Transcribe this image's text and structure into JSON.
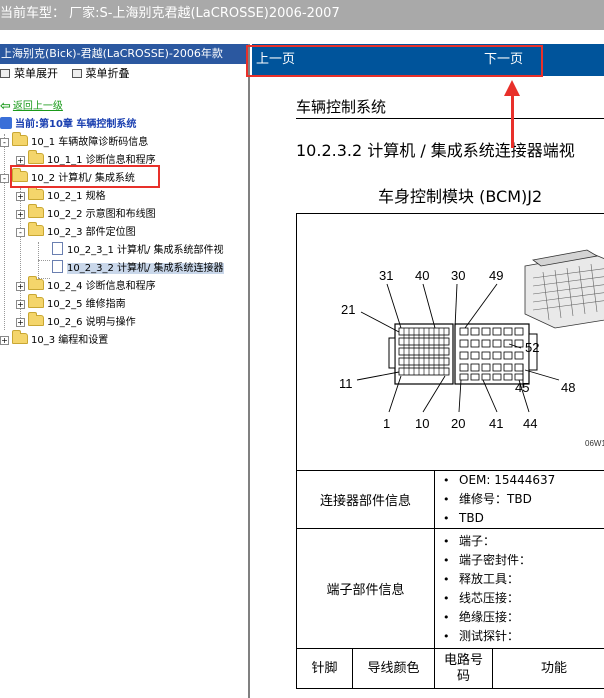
{
  "window": {
    "title": "当前车型：   厂家:S-上海别克君越(LaCROSSE)2006-2007"
  },
  "left_panel": {
    "header": "上海别克(Bick)-君越(LaCROSSE)-2006年款",
    "toolbar": {
      "expand_label": "菜单展开",
      "collapse_label": "菜单折叠"
    },
    "back_link": "返回上一级",
    "current_chapter": "当前:第10章 车辆控制系统",
    "tree": [
      {
        "label": "10_1 车辆故障诊断码信息",
        "expander": "-"
      },
      {
        "label": "10_1_1 诊断信息和程序",
        "expander": "+"
      },
      {
        "label": "10_2 计算机/ 集成系统",
        "expander": "-"
      },
      {
        "label": "10_2_1 规格",
        "expander": "+"
      },
      {
        "label": "10_2_2 示意图和布线图",
        "expander": "+"
      },
      {
        "label": "10_2_3 部件定位图",
        "expander": "-"
      },
      {
        "label": "10_2_3_1 计算机/ 集成系统部件视",
        "expander": ""
      },
      {
        "label": "10_2_3_2 计算机/ 集成系统连接器",
        "expander": ""
      },
      {
        "label": "10_2_4 诊断信息和程序",
        "expander": "+"
      },
      {
        "label": "10_2_5 维修指南",
        "expander": "+"
      },
      {
        "label": "10_2_6 说明与操作",
        "expander": "+"
      },
      {
        "label": "10_3 编程和设置",
        "expander": "+"
      }
    ]
  },
  "right_panel": {
    "nav": {
      "prev_label": "上一页",
      "next_label": "下一页"
    },
    "section_title": "车辆控制系统",
    "subsection_title": "10.2.3.2 计算机 / 集成系统连接器端视",
    "module_title": "车身控制模块 (BCM)J2",
    "diagram": {
      "pin_labels_top": [
        "31",
        "40",
        "30",
        "49"
      ],
      "pin_labels_left": [
        "21",
        "11"
      ],
      "pin_labels_right": [
        "52",
        "45",
        "48"
      ],
      "pin_labels_bottom": [
        "1",
        "10",
        "20",
        "41",
        "44"
      ],
      "figure_code": "06W1"
    },
    "connector_info": {
      "label": "连接器部件信息",
      "items": [
        "OEM: 15444637",
        "维修号：TBD",
        "TBD"
      ]
    },
    "terminal_info": {
      "label": "端子部件信息",
      "items": [
        "端子：",
        "端子密封件：",
        "释放工具：",
        "线芯压接：",
        "绝缘压接：",
        "测试探针："
      ]
    },
    "pin_table_headers": [
      "针脚",
      "导线颜色",
      "电路号码",
      "功能"
    ]
  },
  "colors": {
    "titlebar": "#a9a9a9",
    "left_header": "#2b58a0",
    "nav_bar": "#00549b",
    "annotation_red": "#e8302a",
    "tree_selected": "#c9d7ea",
    "link_green": "#1a9a1a"
  }
}
